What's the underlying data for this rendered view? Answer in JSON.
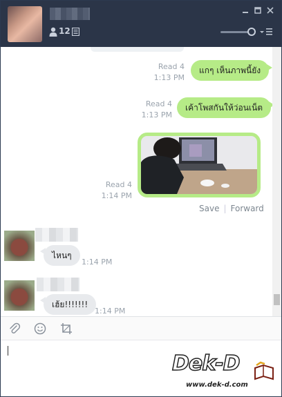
{
  "header": {
    "member_count": "12",
    "icons": [
      "person-icon",
      "note-icon",
      "minimize-icon",
      "maximize-icon",
      "close-icon",
      "menu-icon"
    ]
  },
  "messages": {
    "out1": {
      "read": "Read 4",
      "time": "1:13 PM",
      "text": "แกๆ เห็นภาพนี้ยัง"
    },
    "out2": {
      "read": "Read 4",
      "time": "1:13 PM",
      "text": "เค้าโพสกันให้ว่อนเน็ต"
    },
    "photo": {
      "read": "Read 4",
      "time": "1:14 PM",
      "save": "Save",
      "forward": "Forward"
    },
    "in1": {
      "text": "ไหนๆ",
      "time": "1:14 PM"
    },
    "in2": {
      "text": "เฮ้ย!!!!!!!",
      "time": "1:14 PM"
    }
  },
  "toolbar": {
    "icons": [
      "attach-icon",
      "emoji-icon",
      "crop-icon"
    ]
  },
  "watermark": {
    "logo": "Dek-D",
    "url": "www.dek-d.com"
  },
  "colors": {
    "header": "#2b3548",
    "outgoing_bubble": "#b6eb87",
    "incoming_bubble": "#e8eaed"
  }
}
